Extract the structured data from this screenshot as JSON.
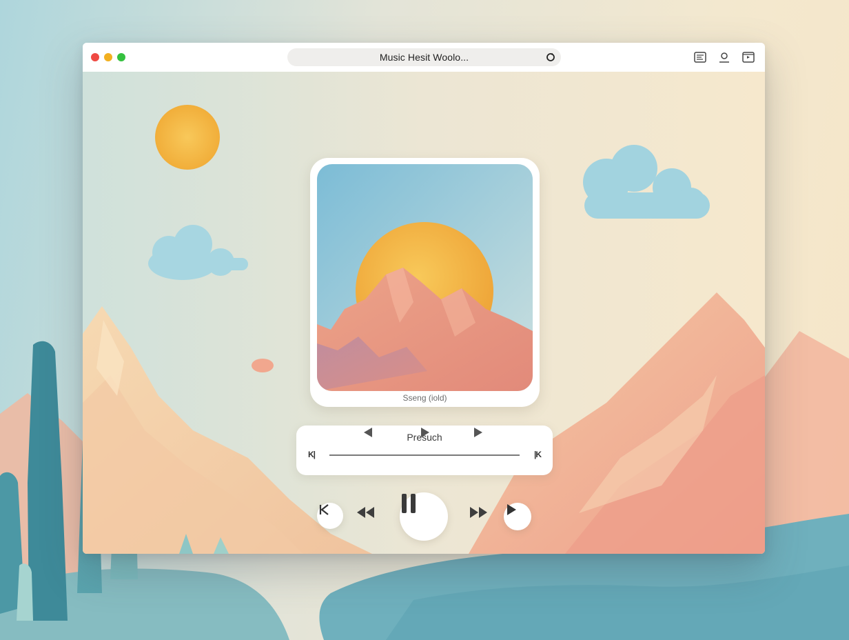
{
  "window": {
    "url_text": "Music Hesit Woolo...",
    "icons": [
      "document-icon",
      "account-icon",
      "share-icon"
    ]
  },
  "player": {
    "song_label": "Sseng (iold)",
    "progress_title": "Presuch",
    "skip_back_label": "K|",
    "skip_forward_label": "|K",
    "state": "playing"
  },
  "controls": [
    "back-button",
    "rewind-button",
    "pause-button",
    "fast-forward-button",
    "play-button"
  ],
  "colors": {
    "sun": "#f4b93e",
    "cloud": "#9fd3df",
    "mountain": "#f0a688",
    "desert": "#f4e3c4"
  }
}
